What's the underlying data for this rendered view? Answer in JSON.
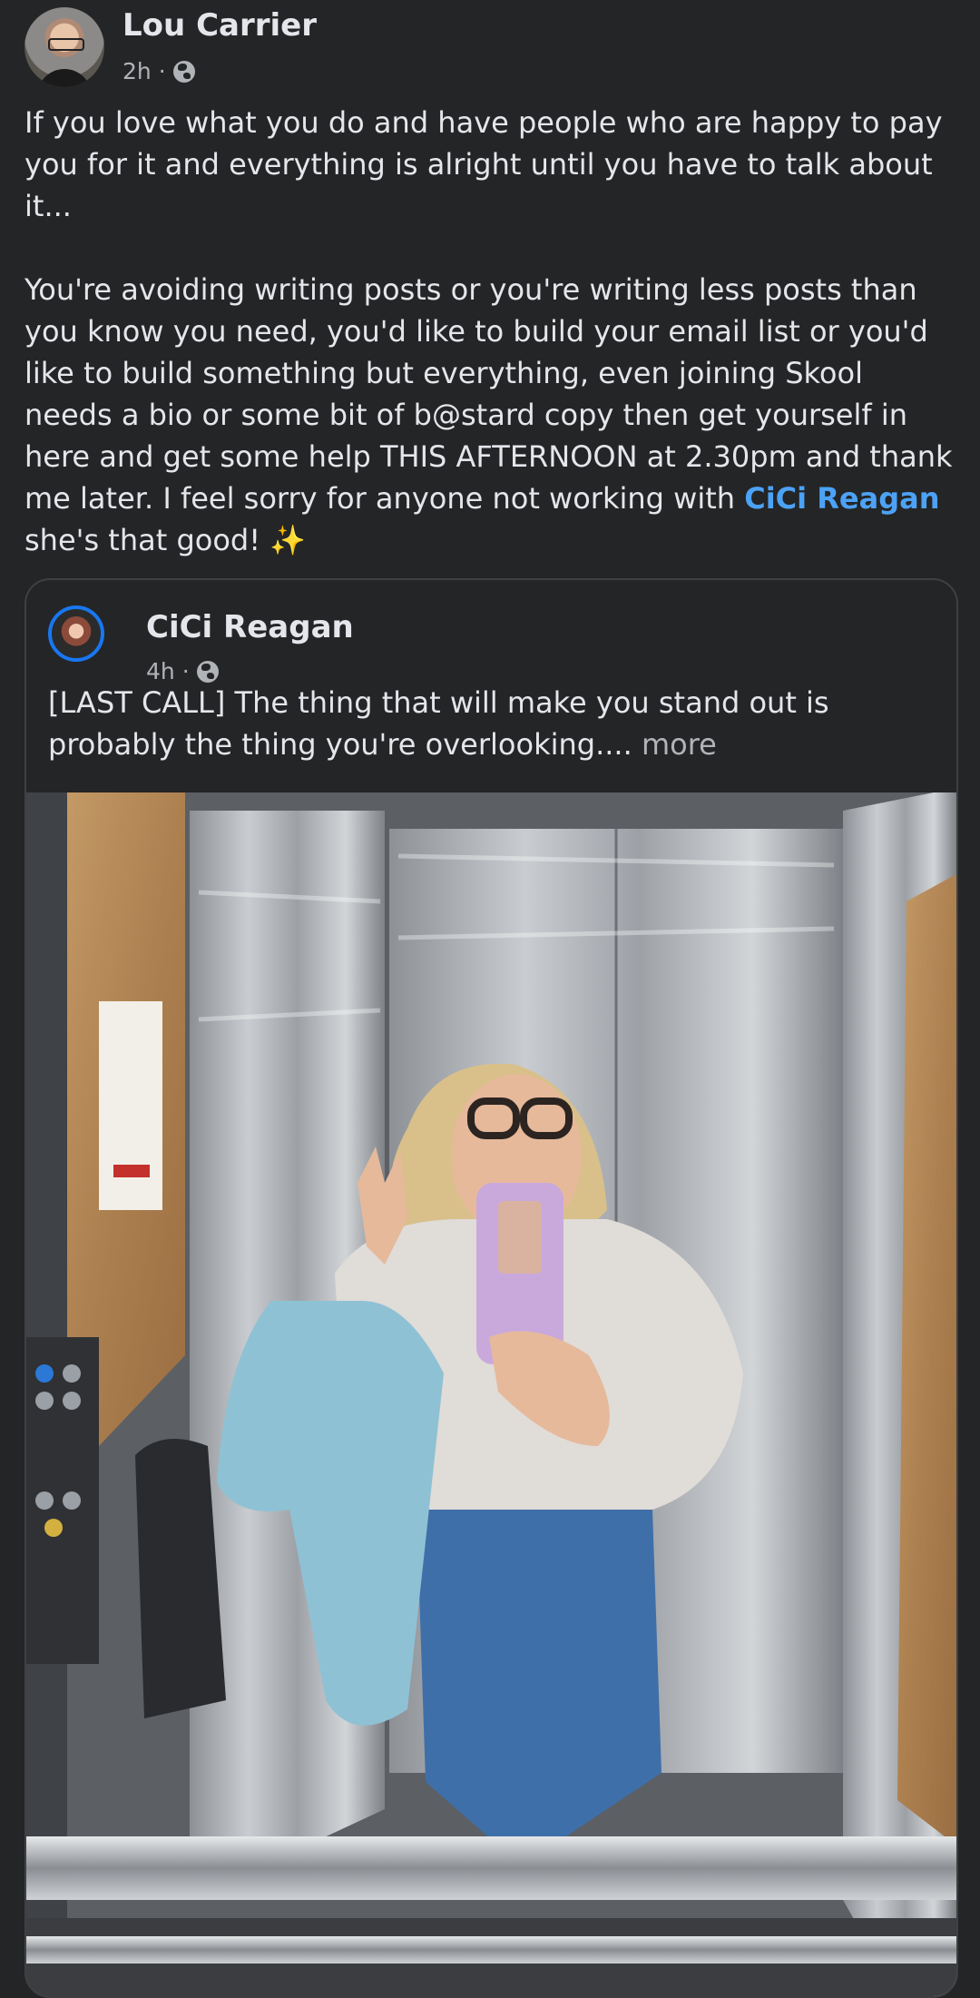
{
  "post": {
    "author": "Lou Carrier",
    "time": "2h",
    "separator": "·",
    "paragraph_1": "If you love what you do and have people who are happy to pay you for it and everything is alright until you have to talk about it...",
    "paragraph_2_before_mention": "You're avoiding writing posts or you're writing less posts than you know you need, you'd like to build your email list or you'd like to build something but everything, even joining Skool needs a bio or some bit of b@stard copy then get yourself in here and get some help THIS AFTERNOON at 2.30pm and thank me later. I feel sorry for anyone not working with ",
    "mention": "CiCi Reagan",
    "paragraph_2_after_mention": " she's that good! ✨"
  },
  "shared_post": {
    "author": "CiCi Reagan",
    "time": "4h",
    "separator": "·",
    "text": "[LAST CALL] The thing that will make you stand out is probably the thing you're overlooking.... ",
    "more_label": "more"
  },
  "icons": {
    "audience": "globe-icon",
    "mention_accent": "#4ca2f5"
  }
}
